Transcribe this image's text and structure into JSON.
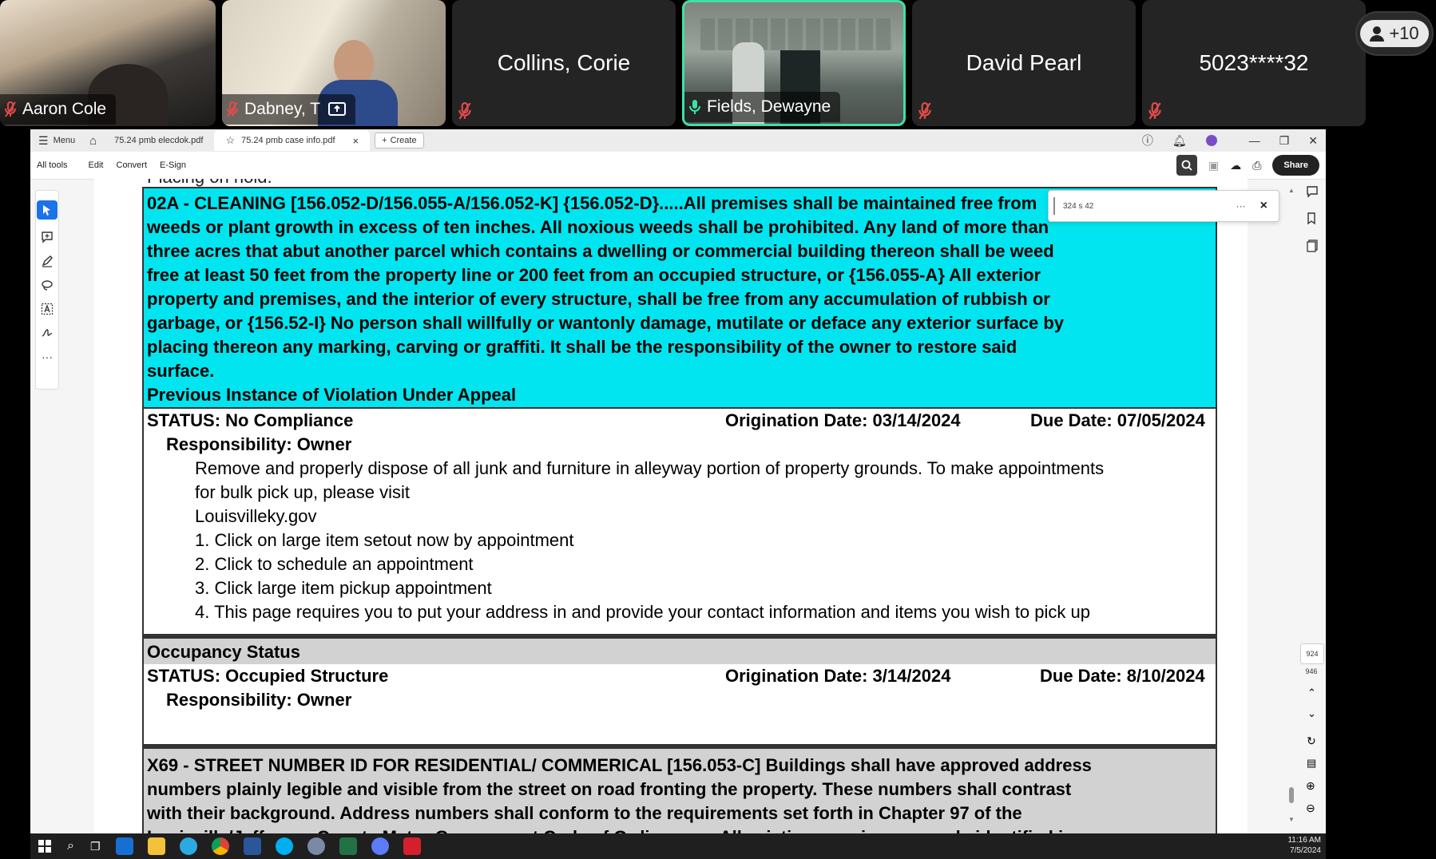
{
  "meeting": {
    "participants": [
      {
        "name": "Aaron Cole"
      },
      {
        "name": "Dabney, T"
      },
      {
        "name": "Collins, Corie"
      },
      {
        "name": "Fields, Dewayne"
      },
      {
        "name": "David Pearl"
      },
      {
        "name": "5023****32"
      }
    ],
    "more_count": "+10"
  },
  "acrobat": {
    "menu_label": "Menu",
    "tabs": [
      {
        "label": "75.24 pmb elecdok.pdf"
      },
      {
        "label": "75.24 pmb case info.pdf"
      }
    ],
    "create_label": "Create",
    "toolbar": {
      "all_tools": "All tools",
      "edit": "Edit",
      "convert": "Convert",
      "esign": "E-Sign",
      "share": "Share"
    },
    "find": {
      "query": "324 s 42",
      "more": "···",
      "close": "×"
    },
    "page_numbers": {
      "current": "924",
      "total": "946"
    }
  },
  "document": {
    "cut_line": "Placing on hold.",
    "violation1": {
      "paragraph": [
        "02A - CLEANING  [156.052-D/156.055-A/156.052-K] {156.052-D}.....All premises shall be maintained free from",
        "weeds or plant growth in excess of ten inches. All noxious weeds shall be prohibited. Any land of more than",
        "three acres that abut another parcel which contains a dwelling or commercial building thereon shall be weed",
        "free at least 50 feet from the property line or 200 feet from an occupied structure, or {156.055-A} All exterior",
        "property and premises, and the interior of every structure, shall be free from any accumulation of rubbish or",
        "garbage, or {156.52-I} No person shall willfully or wantonly damage, mutilate or deface any exterior surface by",
        "placing thereon any marking, carving or graffiti.  It shall be the responsibility of the owner to restore said",
        "surface."
      ],
      "appeal_note": "Previous Instance of Violation Under Appeal",
      "status": "STATUS: No Compliance",
      "origination": "Origination Date: 03/14/2024",
      "due": "Due Date: 07/05/2024",
      "responsibility": "Responsibility: Owner",
      "instructions": [
        "Remove and properly dispose of all junk and furniture in alleyway portion of property grounds. To make appointments",
        "for bulk pick up, please visit",
        "Louisvilleky.gov",
        "1. Click on large item setout now by appointment",
        "2. Click to schedule an appointment",
        "3. Click large item pickup appointment",
        "4. This page requires you to put your address in and provide your contact information and items you wish to pick up"
      ]
    },
    "occupancy": {
      "header": "Occupancy Status",
      "status": "STATUS: Occupied Structure",
      "origination": "Origination Date: 3/14/2024",
      "due": "Due Date: 8/10/2024",
      "responsibility": "Responsibility: Owner"
    },
    "violation2": {
      "paragraph": [
        "X69 - STREET NUMBER ID FOR RESIDENTIAL/ COMMERICAL  [156.053-C] Buildings shall have approved address",
        "numbers  plainly legible and visible from the street on road fronting the property. These numbers shall contrast",
        "with their background. Address numbers shall conform to the requirements set forth in Chapter 97 of the",
        "Louisville/Jefferson County Metro Government Code of Ordinances. All existing premises properly identified in"
      ]
    }
  },
  "taskbar": {
    "time": "11:16 AM",
    "date": "7/5/2024"
  },
  "colors": {
    "highlight": "#00e5ef",
    "active_speaker": "#3fe0a8",
    "section_grey": "#d2d2d2"
  }
}
